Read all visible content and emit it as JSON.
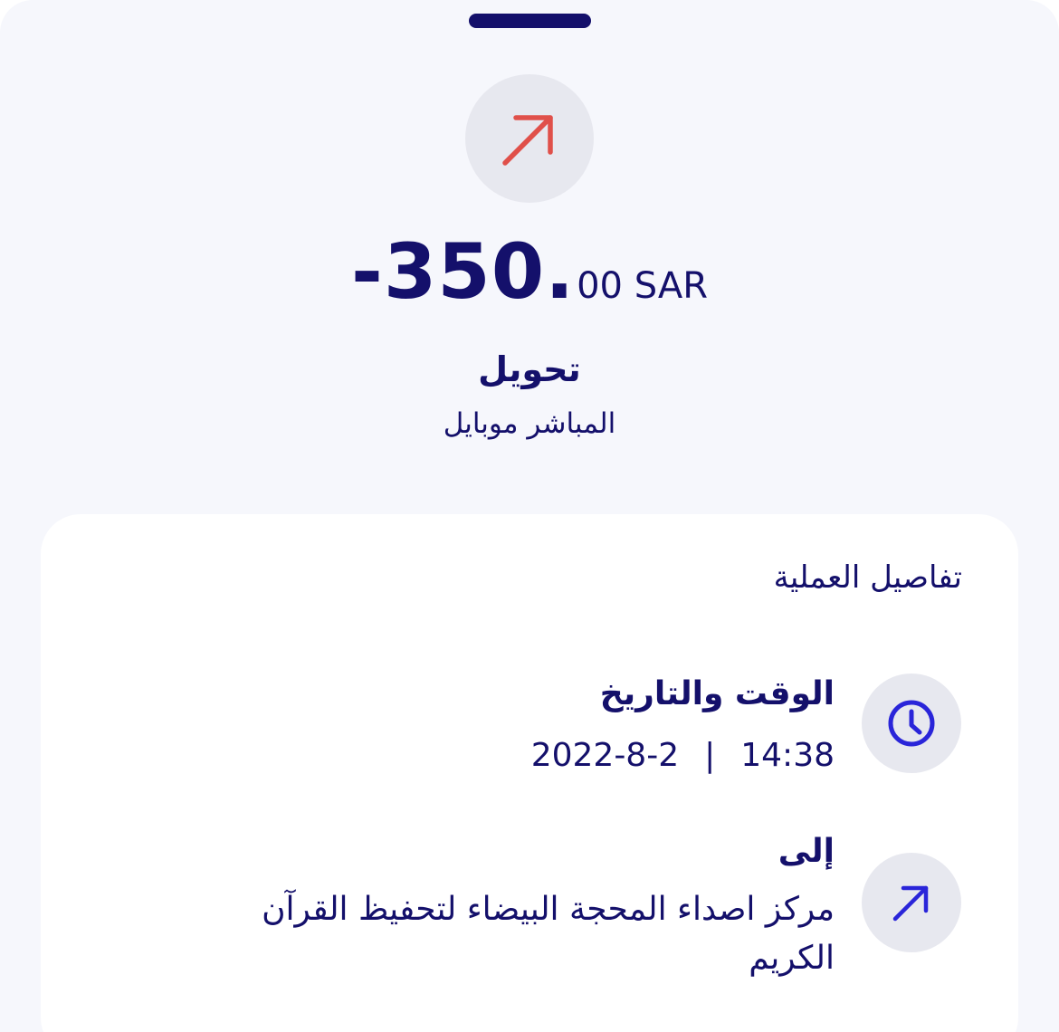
{
  "colors": {
    "primary": "#14106b",
    "accent_blue": "#2a25d9",
    "outgoing_red": "#e0504a",
    "icon_circle_bg": "#e7e8ef",
    "sheet_bg": "#f6f7fc",
    "card_bg": "#ffffff"
  },
  "transaction": {
    "direction_icon": "arrow-up-right-icon",
    "amount_major": "-350.",
    "amount_minor": "00 SAR",
    "type_label": "تحويل",
    "channel_label": "المباشر موبايل"
  },
  "details": {
    "heading": "تفاصيل العملية",
    "datetime": {
      "icon": "clock-icon",
      "label": "الوقت والتاريخ",
      "time": "14:38",
      "separator": "|",
      "date": "2022-8-2"
    },
    "recipient": {
      "icon": "arrow-up-right-icon",
      "label": "إلى",
      "value": "مركز اصداء المحجة البيضاء لتحفيظ القرآن الكريم"
    }
  }
}
